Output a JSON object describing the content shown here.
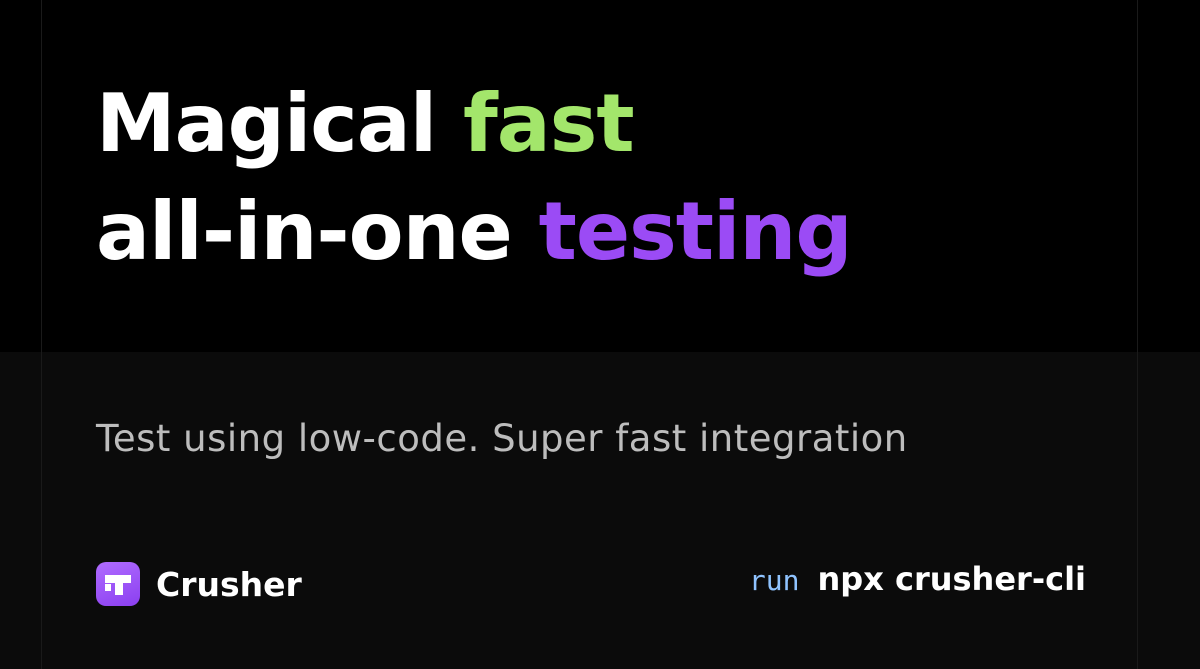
{
  "headline": {
    "line1_prefix": "Magical ",
    "line1_accent": "fast",
    "line2_prefix": "all-in-one ",
    "line2_accent": "testing"
  },
  "subtitle": "Test using low-code. Super fast integration",
  "brand": {
    "name": "Crusher",
    "logo_icon": "crusher-logo-icon"
  },
  "command": {
    "prefix": "run",
    "text": "npx crusher-cli"
  },
  "colors": {
    "background_top": "#000000",
    "background_bottom": "#0b0b0b",
    "accent_green": "#a3e66b",
    "accent_purple": "#9b4bf5",
    "run_blue": "#8fc3ff",
    "text_white": "#ffffff",
    "text_gray": "#bdbdbd"
  }
}
